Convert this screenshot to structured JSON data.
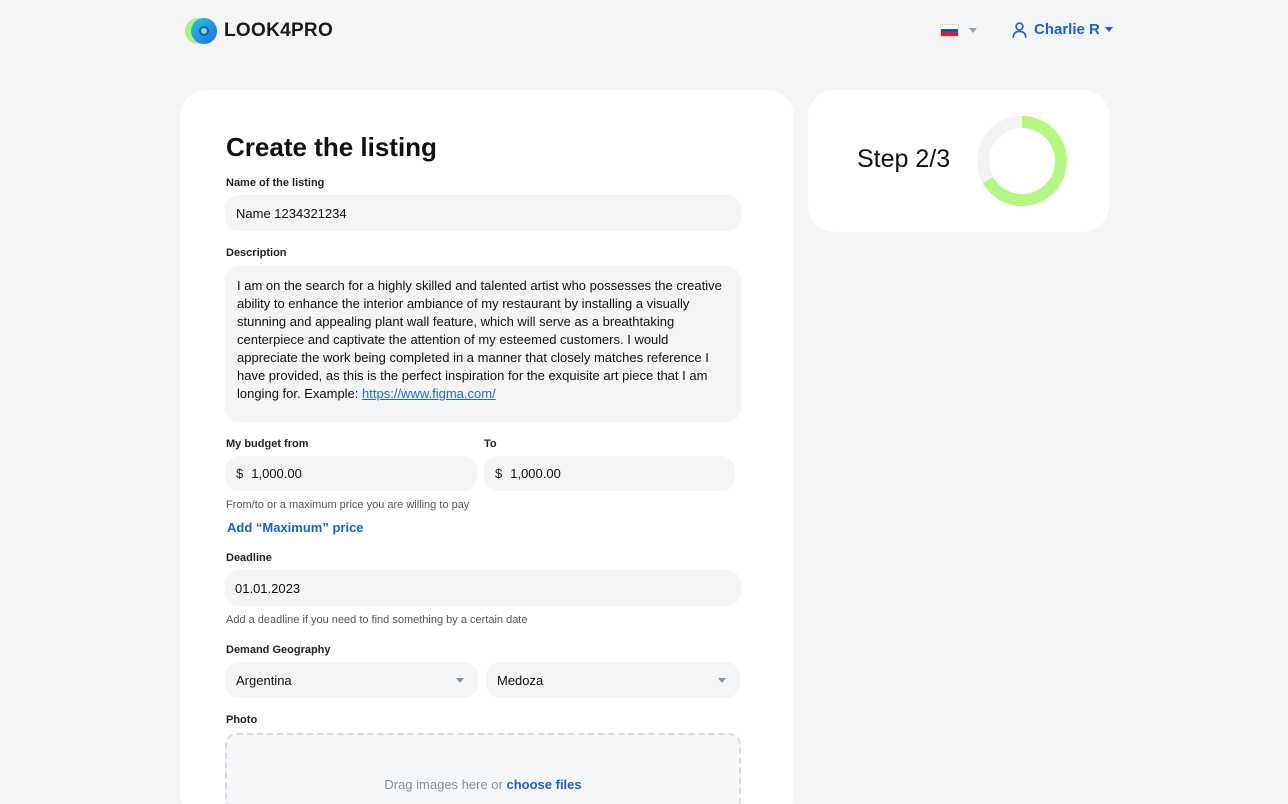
{
  "header": {
    "logo_text": "LOOK4PRO",
    "language_flag": "russia-flag-icon",
    "user_name": "Charlie R"
  },
  "form": {
    "title": "Create the listing",
    "name_label": "Name of the listing",
    "name_value": "Name 1234321234",
    "description_label": "Description",
    "description_lines": [
      "I am on the search for a highly skilled and talented artist who possesses the creative",
      "ability to enhance the interior ambiance of my restaurant by installing a visually",
      "stunning and appealing plant wall feature, which will serve as a breathtaking",
      "centerpiece and captivate the attention of my esteemed customers. I would",
      "appreciate the work being completed in a manner that closely matches reference I",
      "have provided, as this is the perfect inspiration for the exquisite art piece that I am"
    ],
    "description_last_prefix": "longing for. Example: ",
    "description_link": "https://www.figma.com/",
    "budget_from_label": "My budget from",
    "budget_to_label": "To",
    "currency_symbol": "$",
    "budget_from_value": "1,000.00",
    "budget_to_value": "1,000.00",
    "budget_hint": "From/to or a maximum price you are willing to pay",
    "add_max_price": "Add “Maximum” price",
    "deadline_label": "Deadline",
    "deadline_value": "01.01.2023",
    "deadline_hint": "Add a deadline if you need to find something by a certain date",
    "geo_label": "Demand Geography",
    "country_value": "Argentina",
    "region_value": "Medoza",
    "photo_label": "Photo",
    "drop_text": "Drag images here or",
    "choose_files": "choose files"
  },
  "step": {
    "text": "Step 2/3",
    "progress": 0.667,
    "ring_color": "#b4f782",
    "track_color": "#f2f3f5"
  },
  "colors": {
    "accent": "#1c5fd1",
    "background": "#f4f5f7"
  }
}
